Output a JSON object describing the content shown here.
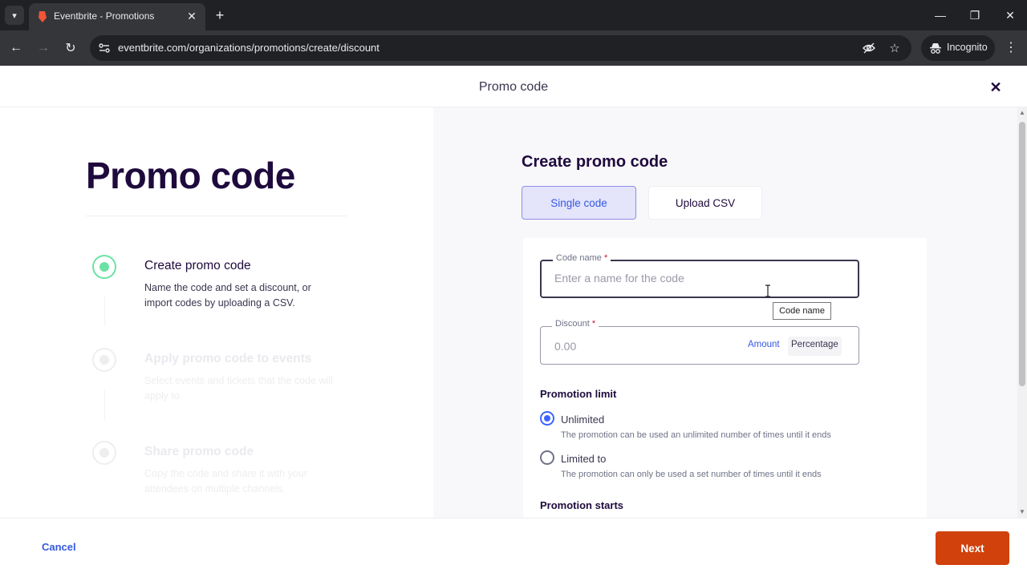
{
  "browser": {
    "tab_title": "Eventbrite - Promotions",
    "url": "eventbrite.com/organizations/promotions/create/discount",
    "incognito_label": "Incognito",
    "accent_color": "#202124"
  },
  "modal": {
    "title": "Promo code"
  },
  "left": {
    "big_title": "Promo code",
    "steps": [
      {
        "title": "Create promo code",
        "description": "Name the code and set a discount, or import codes by uploading a CSV.",
        "state": "active"
      },
      {
        "title": "Apply promo code to events",
        "description": "Select events and tickets that the code will apply to.",
        "state": "inactive"
      },
      {
        "title": "Share promo code",
        "description": "Copy the code and share it with your attendees on multiple channels.",
        "state": "inactive"
      }
    ]
  },
  "form": {
    "title": "Create promo code",
    "tabs": {
      "single": "Single code",
      "upload": "Upload CSV",
      "selected": "Single code"
    },
    "code_name": {
      "label": "Code name",
      "required_mark": "*",
      "placeholder": "Enter a name for the code",
      "value": "",
      "tooltip": "Code name"
    },
    "discount": {
      "label": "Discount",
      "required_mark": "*",
      "value": "0.00",
      "amount_label": "Amount",
      "percentage_label": "Percentage"
    },
    "promotion_limit": {
      "heading": "Promotion limit",
      "options": [
        {
          "label": "Unlimited",
          "description": "The promotion can be used an unlimited number of times until it ends",
          "checked": true
        },
        {
          "label": "Limited to",
          "description": "The promotion can only be used a set number of times until it ends",
          "checked": false
        }
      ]
    },
    "promotion_starts": {
      "heading": "Promotion starts"
    }
  },
  "footer": {
    "cancel_label": "Cancel",
    "next_label": "Next",
    "next_color": "#d1410c"
  }
}
